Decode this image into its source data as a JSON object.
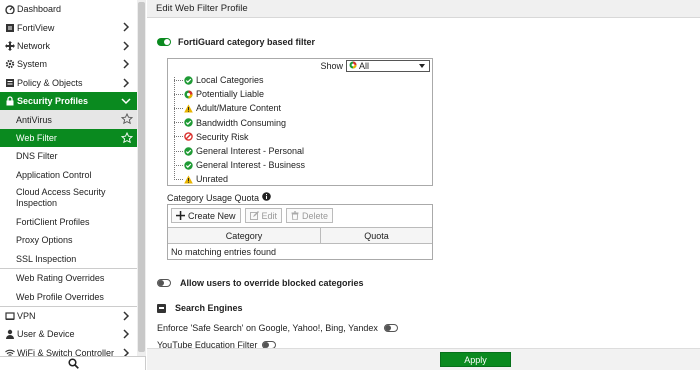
{
  "sidebar": {
    "items": [
      {
        "label": "Dashboard",
        "icon": "dashboard-icon",
        "chevron": false
      },
      {
        "label": "FortiView",
        "icon": "fortiview-icon",
        "chevron": true
      },
      {
        "label": "Network",
        "icon": "network-icon",
        "chevron": true
      },
      {
        "label": "System",
        "icon": "gear-icon",
        "chevron": true
      },
      {
        "label": "Policy & Objects",
        "icon": "policy-icon",
        "chevron": true
      },
      {
        "label": "Security Profiles",
        "icon": "lock-icon",
        "chevron": true
      }
    ],
    "sub_items": [
      {
        "label": "AntiVirus"
      },
      {
        "label": "Web Filter"
      },
      {
        "label": "DNS Filter"
      },
      {
        "label": "Application Control"
      },
      {
        "label": "Cloud Access Security Inspection"
      },
      {
        "label": "FortiClient Profiles"
      },
      {
        "label": "Proxy Options"
      },
      {
        "label": "SSL Inspection"
      },
      {
        "label": "Web Rating Overrides"
      },
      {
        "label": "Web Profile Overrides"
      }
    ],
    "bottom_items": [
      {
        "label": "VPN",
        "icon": "vpn-icon"
      },
      {
        "label": "User & Device",
        "icon": "user-icon"
      },
      {
        "label": "WiFi & Switch Controller",
        "icon": "wifi-icon"
      }
    ]
  },
  "header": {
    "title": "Edit Web Filter Profile"
  },
  "fortiguard": {
    "label": "FortiGuard category based filter",
    "enabled": true
  },
  "show": {
    "label": "Show",
    "value": "All"
  },
  "categories": [
    {
      "label": "Local Categories",
      "status": "allow"
    },
    {
      "label": "Potentially Liable",
      "status": "mixed"
    },
    {
      "label": "Adult/Mature Content",
      "status": "warning"
    },
    {
      "label": "Bandwidth Consuming",
      "status": "allow"
    },
    {
      "label": "Security Risk",
      "status": "block"
    },
    {
      "label": "General Interest - Personal",
      "status": "allow"
    },
    {
      "label": "General Interest - Business",
      "status": "allow"
    },
    {
      "label": "Unrated",
      "status": "warning"
    }
  ],
  "quota": {
    "title": "Category Usage Quota",
    "buttons": {
      "create": "Create New",
      "edit": "Edit",
      "delete": "Delete"
    },
    "columns": [
      "Category",
      "Quota"
    ],
    "empty": "No matching entries found"
  },
  "override": {
    "label": "Allow users to override blocked categories",
    "enabled": false
  },
  "search_engines": {
    "label": "Search Engines",
    "safe_search": "Enforce 'Safe Search' on Google, Yahoo!, Bing, Yandex",
    "youtube": "YouTube Education Filter"
  },
  "footer": {
    "apply": "Apply"
  },
  "colors": {
    "accent": "#0a8a1f",
    "allow": "#1f9a35",
    "block": "#d9302c",
    "warning": "#e8b400"
  }
}
